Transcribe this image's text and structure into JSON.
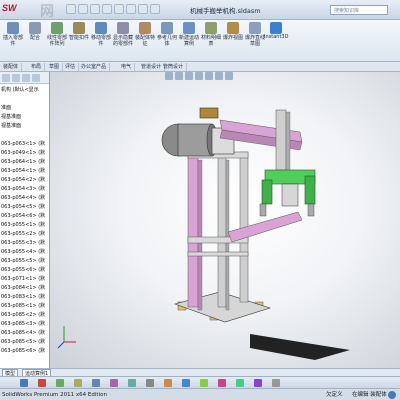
{
  "window": {
    "title": "机械手搬举机构.sldasm",
    "search_placeholder": "搜索知识库",
    "ghost_logo": "网"
  },
  "ribbon": {
    "buttons": [
      {
        "label": "插入零部件",
        "icon": "insert-component-icon",
        "color": "#6f8fb9"
      },
      {
        "label": "配合",
        "icon": "mate-icon",
        "color": "#8a9ab0"
      },
      {
        "label": "线性零部件阵列",
        "icon": "linear-pattern-icon",
        "color": "#6fa06f"
      },
      {
        "label": "智能扣件",
        "icon": "smart-fastener-icon",
        "color": "#9a8a5a"
      },
      {
        "label": "移动零部件",
        "icon": "move-component-icon",
        "color": "#5f8ac0"
      },
      {
        "label": "显示隐藏的零部件",
        "icon": "show-hidden-icon",
        "color": "#8e8ea8"
      },
      {
        "label": "装配体特征",
        "icon": "assembly-feature-icon",
        "color": "#b08a60"
      },
      {
        "label": "参考几何体",
        "icon": "reference-geometry-icon",
        "color": "#7c97b8"
      },
      {
        "label": "新建运动算例",
        "icon": "motion-study-icon",
        "color": "#6c8fc4"
      },
      {
        "label": "材料明细表",
        "icon": "bom-icon",
        "color": "#8ba06c"
      },
      {
        "label": "爆炸视图",
        "icon": "exploded-view-icon",
        "color": "#b38c4a"
      },
      {
        "label": "爆炸直线草图",
        "icon": "explode-line-icon",
        "color": "#8aa0bd"
      }
    ],
    "instant_label": "Instant3D"
  },
  "tabs": [
    "装配体",
    "布局",
    "草图",
    "评估",
    "办公室产品",
    "电气",
    "管道设计",
    "管筒设计"
  ],
  "feature_tree": {
    "filter_label": "过滤",
    "rows": [
      "机构 (默认<显示",
      "",
      "准面",
      "视基准面",
      "视基准面",
      "",
      "063-p063<1> (默",
      "063-p049<1> (默",
      "063-p064<1> (默",
      "063-p054<1> (默",
      "063-p054<2> (默",
      "063-p054<3> (默",
      "063-p054<4> (默",
      "063-p054<5> (默",
      "063-p054<6> (默",
      "063-p055<1> (默",
      "063-p055<2> (默",
      "063-p055<3> (默",
      "063-p055<4> (默",
      "063-p055<5> (默",
      "063-p055<6> (默",
      "063-p071<1> (默",
      "063-p084<1> (默",
      "063-p083<1> (默",
      "063-p085<1> (默",
      "063-p085<2> (默",
      "063-p085<3> (默",
      "063-p085<4> (默",
      "063-p085<5> (默",
      "063-p085<6> (默"
    ]
  },
  "bottom_tabs": [
    "模型",
    "运动算例1"
  ],
  "status": {
    "edition": "SolidWorks Premium 2011 x64 Edition",
    "under_defined": "欠定义",
    "editing": "在编辑 装配体"
  },
  "colors": {
    "frame_pink": "#d9a3d6",
    "gripper_green": "#4fcf5a",
    "frame_grey": "#c9c9c9",
    "logo_red": "#c8102e"
  }
}
